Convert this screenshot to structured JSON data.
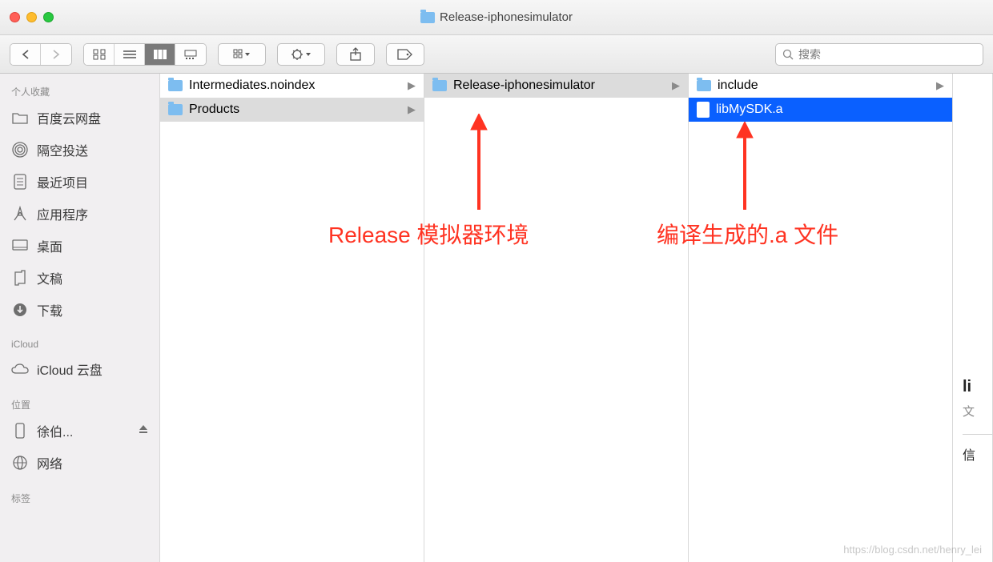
{
  "window": {
    "title": "Release-iphonesimulator"
  },
  "search": {
    "placeholder": "搜索"
  },
  "sidebar": {
    "sections": [
      {
        "header": "个人收藏",
        "items": [
          {
            "label": "百度云网盘",
            "icon": "folder"
          },
          {
            "label": "隔空投送",
            "icon": "airdrop"
          },
          {
            "label": "最近项目",
            "icon": "recent"
          },
          {
            "label": "应用程序",
            "icon": "apps"
          },
          {
            "label": "桌面",
            "icon": "desktop"
          },
          {
            "label": "文稿",
            "icon": "documents"
          },
          {
            "label": "下载",
            "icon": "downloads"
          }
        ]
      },
      {
        "header": "iCloud",
        "items": [
          {
            "label": "iCloud 云盘",
            "icon": "cloud"
          }
        ]
      },
      {
        "header": "位置",
        "items": [
          {
            "label": "徐伯...",
            "icon": "phone",
            "eject": true
          },
          {
            "label": "网络",
            "icon": "network"
          }
        ]
      },
      {
        "header": "标签",
        "items": []
      }
    ]
  },
  "columns": {
    "col1": [
      {
        "name": "Intermediates.noindex",
        "type": "folder",
        "selected": false
      },
      {
        "name": "Products",
        "type": "folder",
        "selected": true
      }
    ],
    "col2": [
      {
        "name": "Release-iphonesimulator",
        "type": "folder",
        "selected": true
      }
    ],
    "col3": [
      {
        "name": "include",
        "type": "folder",
        "selected": false
      },
      {
        "name": "libMySDK.a",
        "type": "file",
        "selected": true
      }
    ]
  },
  "preview": {
    "title_fragment": "li",
    "subtitle_fragment": "文",
    "info_fragment": "信"
  },
  "annotations": {
    "left": "Release 模拟器环境",
    "right": "编译生成的.a 文件"
  },
  "watermark": "https://blog.csdn.net/henry_lei"
}
